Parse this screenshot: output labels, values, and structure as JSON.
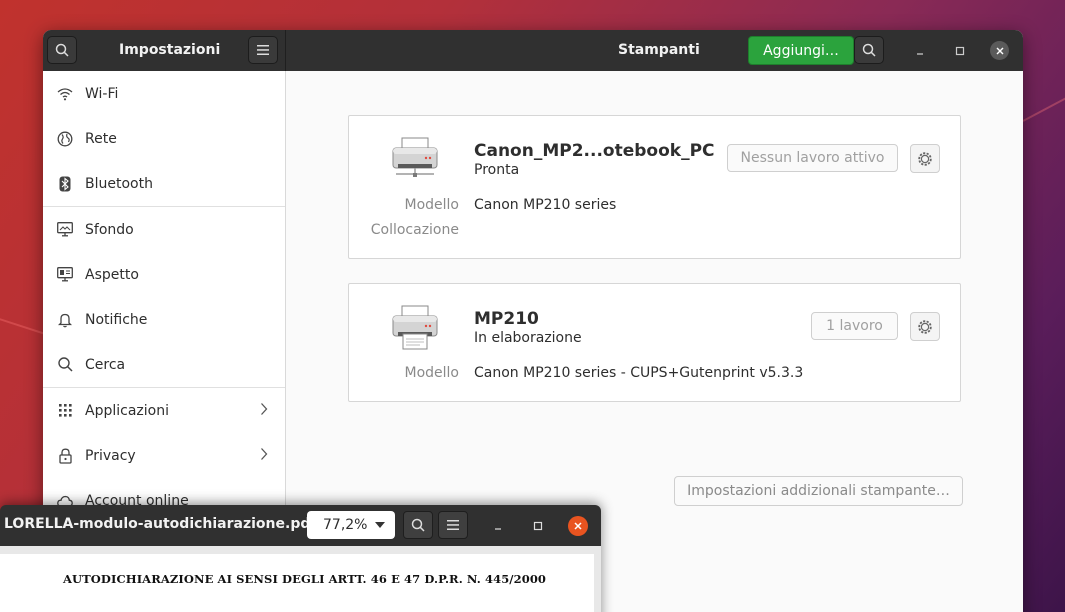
{
  "settings": {
    "sidebar_title": "Impostazioni",
    "panel_title": "Stampanti",
    "add_button": "Aggiungi…",
    "nav": [
      {
        "label": "Wi-Fi",
        "icon": "wifi-icon"
      },
      {
        "label": "Rete",
        "icon": "globe-icon"
      },
      {
        "label": "Bluetooth",
        "icon": "bluetooth-icon"
      },
      {
        "label": "Sfondo",
        "icon": "background-icon"
      },
      {
        "label": "Aspetto",
        "icon": "appearance-icon"
      },
      {
        "label": "Notifiche",
        "icon": "bell-icon"
      },
      {
        "label": "Cerca",
        "icon": "search-icon"
      },
      {
        "label": "Applicazioni",
        "icon": "apps-grid-icon"
      },
      {
        "label": "Privacy",
        "icon": "lock-icon"
      },
      {
        "label": "Account online",
        "icon": "cloud-icon"
      }
    ]
  },
  "printers": [
    {
      "name": "Canon_MP2...otebook_PC",
      "status": "Pronta",
      "jobs_button": "Nessun lavoro attivo",
      "model_label": "Modello",
      "model_value": "Canon MP210 series",
      "location_label": "Collocazione",
      "location_value": ""
    },
    {
      "name": "MP210",
      "status": "In elaborazione",
      "jobs_button": "1 lavoro",
      "model_label": "Modello",
      "model_value": "Canon MP210 series - CUPS+Gutenprint v5.3.3"
    }
  ],
  "extra_settings_button": "Impostazioni addizionali stampante…",
  "pdf": {
    "title": "LORELLA-modulo-autodichiarazione.pdf",
    "zoom": "77,2%",
    "heading": "AUTODICHIARAZIONE AI SENSI DEGLI ARTT. 46 E 47 D.P.R. N. 445/2000"
  },
  "colors": {
    "accent_green": "#2ba33d",
    "headerbar": "#303030",
    "close_orange": "#e95420"
  }
}
